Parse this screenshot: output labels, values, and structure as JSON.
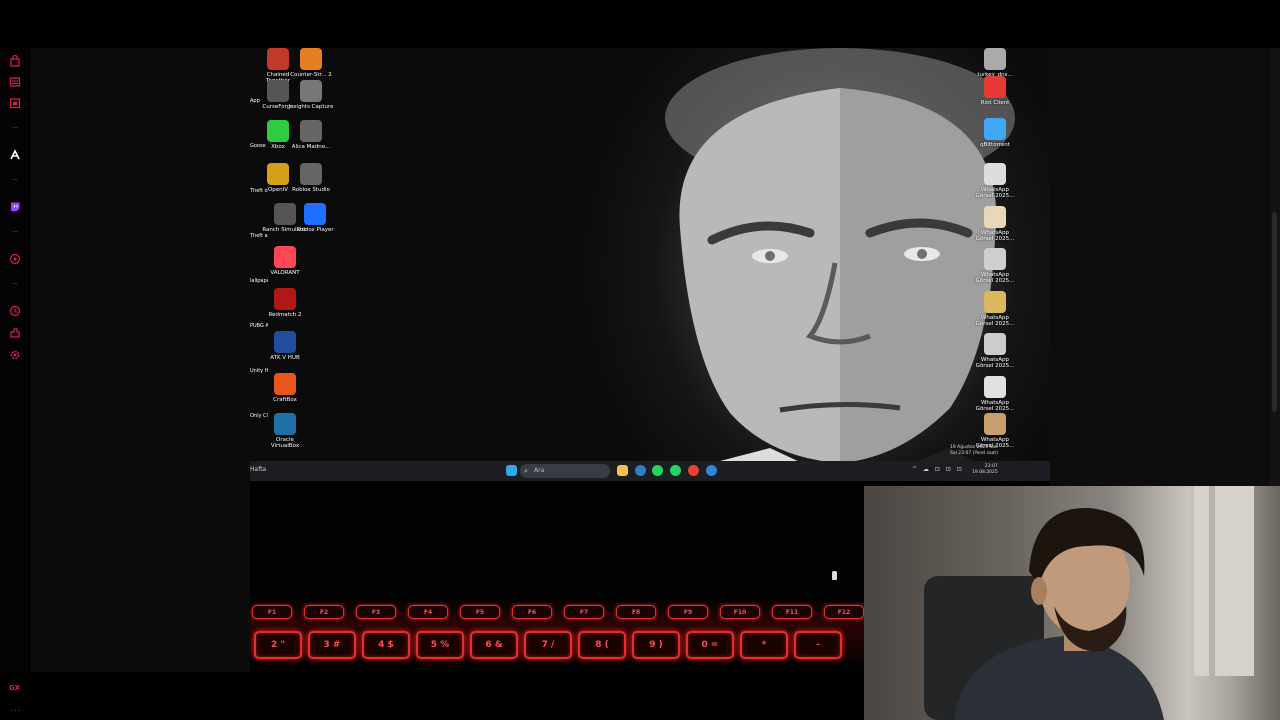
{
  "desktop": {
    "left_icons": [
      {
        "label": "Chained Together",
        "color": "#c0392b"
      },
      {
        "label": "Counter-Str... 2",
        "color": "#e67e22"
      },
      {
        "label": "CurseForge",
        "color": "#555555"
      },
      {
        "label": "Insights Capture",
        "color": "#777777"
      },
      {
        "label": "Xbox",
        "color": "#2ecc40"
      },
      {
        "label": "Alica Madno...",
        "color": "#666666"
      },
      {
        "label": "OpenIV",
        "color": "#d4a017"
      },
      {
        "label": "Roblox Studio",
        "color": "#666666"
      },
      {
        "label": "Ranch Simulator",
        "color": "#555555"
      },
      {
        "label": "Roblox Player",
        "color": "#1e6fff"
      },
      {
        "label": "VALORANT",
        "color": "#ff4655"
      },
      {
        "label": "Redmatch 2",
        "color": "#b01818"
      },
      {
        "label": "ATK V HUB",
        "color": "#1f4e9e"
      },
      {
        "label": "CraftBox",
        "color": "#e8561c"
      },
      {
        "label": "Oracle VirtualBox",
        "color": "#1f6fa8"
      }
    ],
    "left_edge_labels": [
      "App",
      "Goose",
      "Theft o IV",
      "Theft ato V",
      "lallpaper Engine",
      "PUBG ATTLEGR...",
      "Unity Hub",
      "Only Climb Better To..."
    ],
    "right_icons": [
      {
        "label": "turkey_dns...",
        "color": "#aaaaaa"
      },
      {
        "label": "Riot Client",
        "color": "#e53935"
      },
      {
        "label": "qBittorrent",
        "color": "#3fa9f5"
      },
      {
        "label": "WhatsApp Görsel 2025...",
        "color": "#dddddd"
      },
      {
        "label": "WhatsApp Görsel 2025...",
        "color": "#e8d8b8"
      },
      {
        "label": "WhatsApp Görsel 2025...",
        "color": "#cfcfcf"
      },
      {
        "label": "WhatsApp Görsel 2025...",
        "color": "#d9b860"
      },
      {
        "label": "WhatsApp Görsel 2025...",
        "color": "#cccccc"
      },
      {
        "label": "WhatsApp Görsel 2025...",
        "color": "#e0e0e0"
      },
      {
        "label": "WhatsApp Görsel 2025...",
        "color": "#c8a070"
      }
    ]
  },
  "taskbar": {
    "left_text": "Hafta",
    "search_placeholder": "Ara",
    "apps": [
      {
        "name": "start-icon",
        "color": "#2fa9e8"
      },
      {
        "name": "file-explorer-icon",
        "color": "#f2c14e"
      },
      {
        "name": "mail-icon",
        "color": "#2f80c8"
      },
      {
        "name": "spotify-icon",
        "color": "#1ed760"
      },
      {
        "name": "whatsapp-icon",
        "color": "#25d366"
      },
      {
        "name": "chrome-icon",
        "color": "#e94235"
      },
      {
        "name": "edge-icon",
        "color": "#2f86d8"
      }
    ],
    "tray": "^ ☁ ⊡ ⊡ ⊡",
    "time": "23:07",
    "date": "19.08.2025"
  },
  "toast": {
    "line1": "19 Ağustos 2025 Salı",
    "line2": "Sal 23:07 (Yerel saat)"
  },
  "keyboard": {
    "top_row": [
      "F1",
      "F2",
      "F3",
      "F4",
      "F5",
      "F6",
      "F7",
      "F8",
      "F9",
      "F10",
      "F11",
      "F12"
    ],
    "number_row": [
      "2 \"",
      "3 #",
      "4 $",
      "5 %",
      "6 &",
      "7 /",
      "8 (",
      "9 )",
      "0 =",
      "*",
      "-"
    ]
  },
  "sidebar": {
    "badge": "GX",
    "more": "..."
  }
}
